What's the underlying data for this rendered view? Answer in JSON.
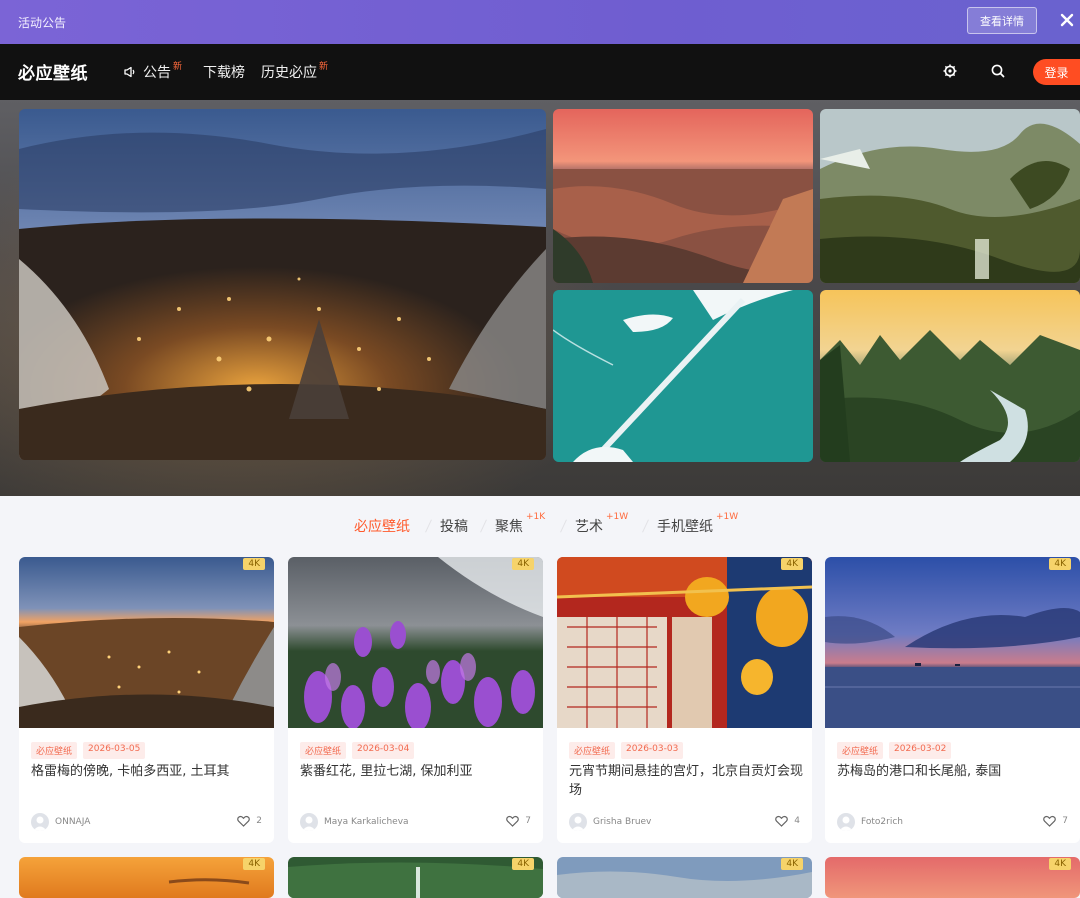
{
  "announcement": {
    "text": "活动公告",
    "detail_label": "查看详情"
  },
  "nav": {
    "logo": "必应壁纸",
    "items": [
      {
        "label": "公告",
        "new": "新"
      },
      {
        "label": "下载榜"
      },
      {
        "label": "历史必应",
        "new": "新"
      }
    ],
    "login_label": "登录"
  },
  "tabs": [
    {
      "label": "必应壁纸",
      "active": true
    },
    {
      "label": "投稿"
    },
    {
      "label": "聚焦",
      "count": "+1K"
    },
    {
      "label": "艺术",
      "count": "+1W"
    },
    {
      "label": "手机壁纸",
      "count": "+1W"
    }
  ],
  "cards": [
    {
      "badge": "4K",
      "category": "必应壁纸",
      "date": "2026-03-05",
      "title": "格雷梅的傍晚, 卡帕多西亚, 土耳其",
      "author": "ONNAJA",
      "likes": "2"
    },
    {
      "badge": "4K",
      "category": "必应壁纸",
      "date": "2026-03-04",
      "title": "紫番红花, 里拉七湖, 保加利亚",
      "author": "Maya Karkalicheva",
      "likes": "7"
    },
    {
      "badge": "4K",
      "category": "必应壁纸",
      "date": "2026-03-03",
      "title": "元宵节期间悬挂的宫灯，北京自贡灯会现场",
      "author": "Grisha Bruev",
      "likes": "4"
    },
    {
      "badge": "4K",
      "category": "必应壁纸",
      "date": "2026-03-02",
      "title": "苏梅岛的港口和长尾船, 泰国",
      "author": "Foto2rich",
      "likes": "7"
    }
  ],
  "row2_badges": [
    "4K",
    "4K",
    "4K",
    "4K"
  ],
  "colors": {
    "accent": "#ff5a2c",
    "login": "#ff4d22",
    "announce": "#7363d3",
    "badge": "#f6d36a"
  }
}
